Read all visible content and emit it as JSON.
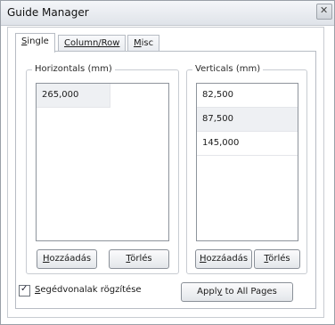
{
  "window": {
    "title": "Guide Manager",
    "close_glyph": "✕"
  },
  "tabs": [
    {
      "label": "Single",
      "accel": "S",
      "rest": "ingle"
    },
    {
      "label": "Column/Row",
      "accel": "C",
      "rest": "olumn/Row"
    },
    {
      "label": "Misc",
      "accel": "M",
      "rest": "isc"
    }
  ],
  "horizontals": {
    "legend": "Horizontals (mm)",
    "items": [
      "265,000"
    ],
    "add_button": {
      "label": "Hozzáadás",
      "accel": "H",
      "rest": "ozzáadás"
    },
    "delete_button": {
      "label": "Törlés",
      "accel": "T",
      "rest": "örlés"
    }
  },
  "verticals": {
    "legend": "Verticals (mm)",
    "items": [
      "82,500",
      "87,500",
      "145,000"
    ],
    "add_button": {
      "label": "Hozzáadás",
      "accel": "H",
      "rest": "ozzáadás"
    },
    "delete_button": {
      "label": "Törlés",
      "accel": "T",
      "rest": "örlés"
    }
  },
  "lock_guides": {
    "label": "Segédvonalak rögzítése",
    "accel": "S",
    "rest": "egédvonalak rögzítése",
    "checked": true,
    "check_glyph": "✓"
  },
  "apply_button": {
    "label": "Apply to All Pages",
    "pre": "Appl",
    "accel": "y",
    "post": " to All Pages"
  }
}
